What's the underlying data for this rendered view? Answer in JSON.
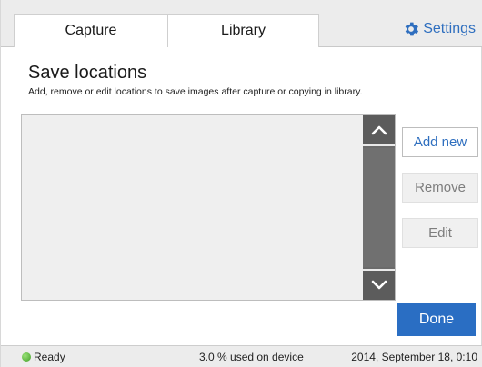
{
  "tabs": {
    "capture": "Capture",
    "library": "Library",
    "settings": "Settings"
  },
  "section": {
    "title": "Save locations",
    "description": "Add, remove or edit locations to save images after capture or copying in library."
  },
  "buttons": {
    "add_new": "Add new",
    "remove": "Remove",
    "edit": "Edit",
    "done": "Done"
  },
  "status": {
    "ready": "Ready",
    "usage": "3.0 % used on device",
    "datetime": "2014, September 18, 0:10"
  },
  "icons": {
    "settings": "gear-icon",
    "scroll_up": "chevron-up-icon",
    "scroll_down": "chevron-down-icon",
    "status": "status-dot-icon"
  },
  "colors": {
    "accent": "#2a6ec3",
    "link": "#2f6fbf",
    "status_ok": "#3f9e25",
    "scrollbar": "#6b6b6b"
  }
}
